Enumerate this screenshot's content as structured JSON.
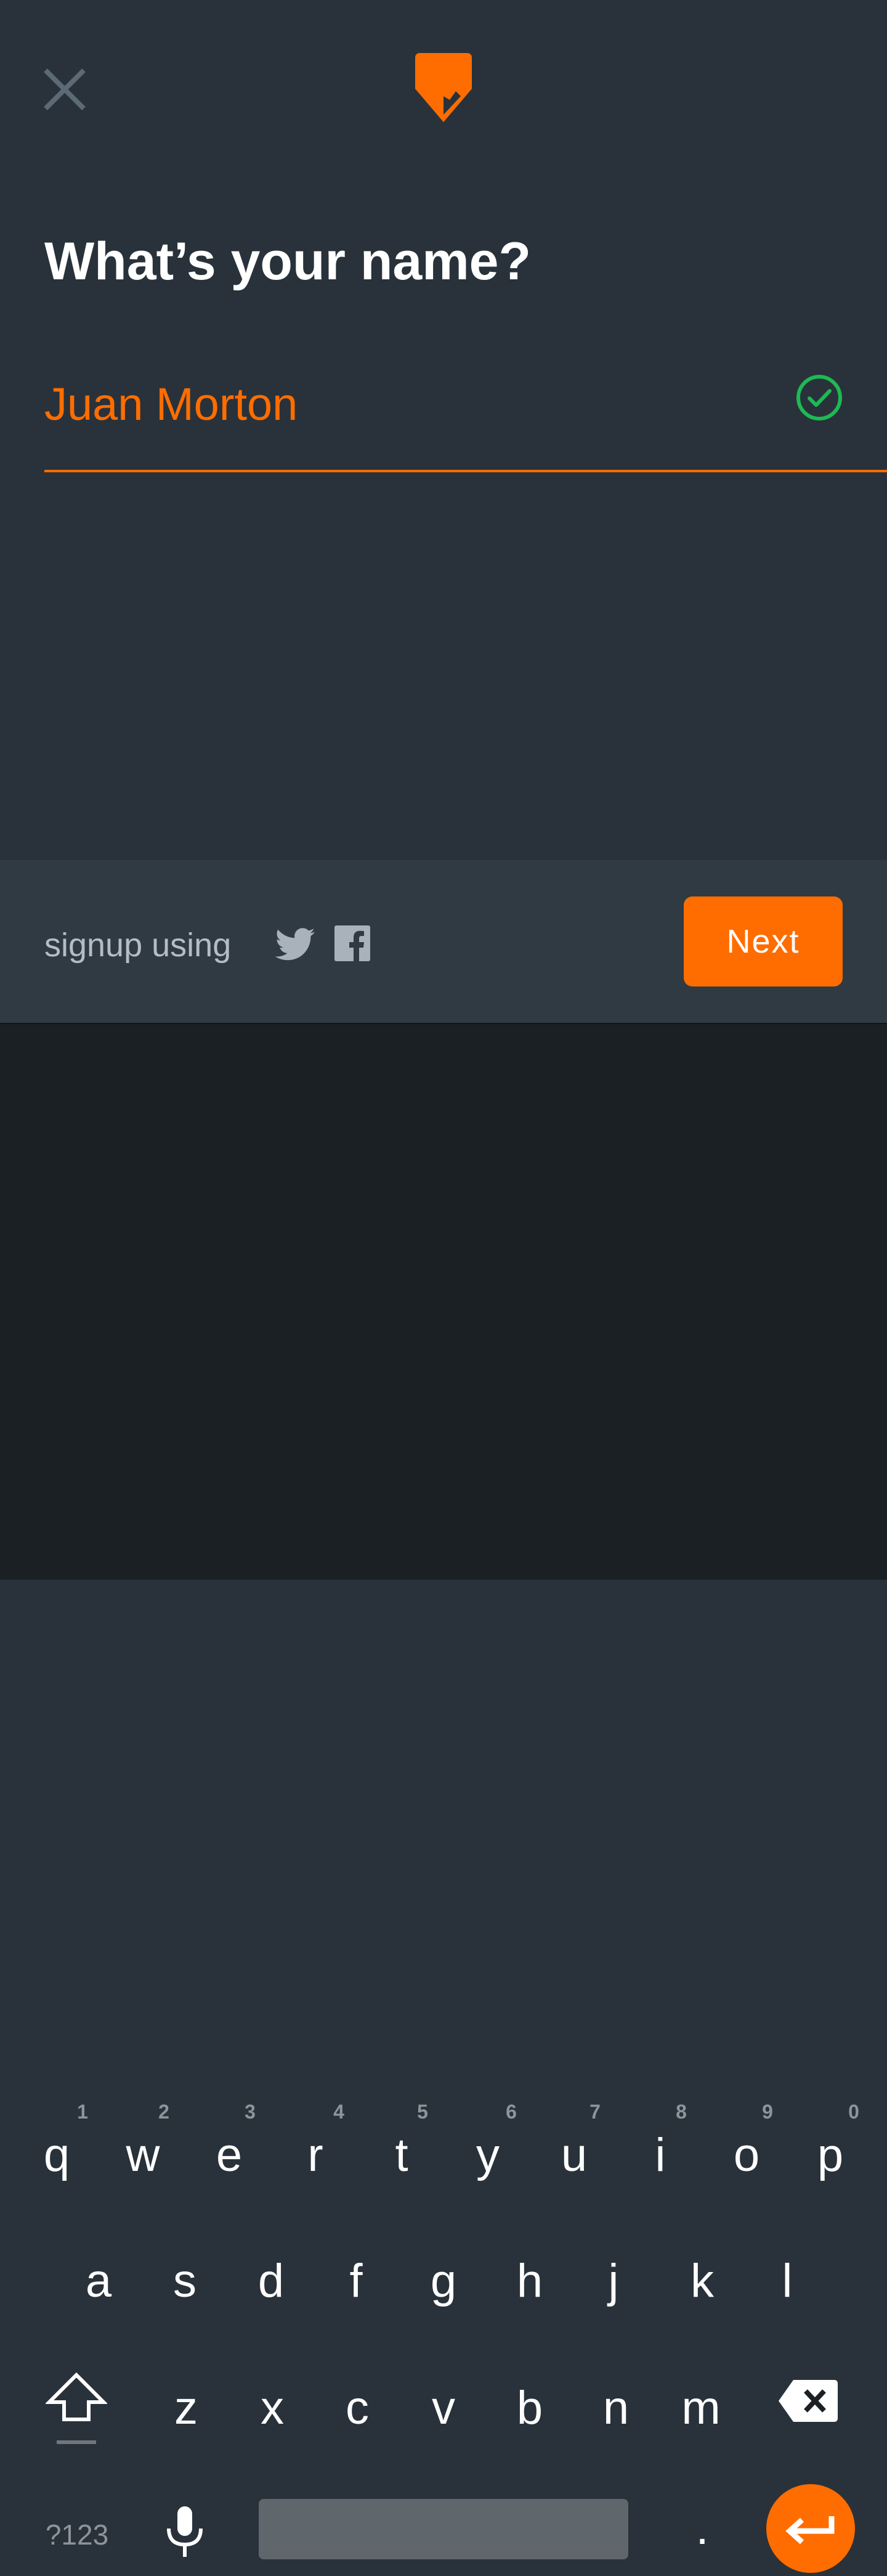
{
  "header": {
    "close_icon": "close-icon",
    "logo_icon": "pin-logo-icon"
  },
  "form": {
    "title": "What’s your name?",
    "name_value": "Juan Morton",
    "valid_icon": "check-circle-icon"
  },
  "signup": {
    "label": "signup using",
    "twitter_icon": "twitter-icon",
    "facebook_icon": "facebook-icon",
    "next_label": "Next"
  },
  "keyboard": {
    "row1": [
      "q",
      "w",
      "e",
      "r",
      "t",
      "y",
      "u",
      "i",
      "o",
      "p"
    ],
    "row1_hints": [
      "1",
      "2",
      "3",
      "4",
      "5",
      "6",
      "7",
      "8",
      "9",
      "0"
    ],
    "row2": [
      "a",
      "s",
      "d",
      "f",
      "g",
      "h",
      "j",
      "k",
      "l"
    ],
    "row3": [
      "z",
      "x",
      "c",
      "v",
      "b",
      "n",
      "m"
    ],
    "symbols_label": "?123",
    "period_label": "."
  },
  "colors": {
    "accent": "#ff6d00",
    "background": "#29323a",
    "valid": "#1db954"
  }
}
